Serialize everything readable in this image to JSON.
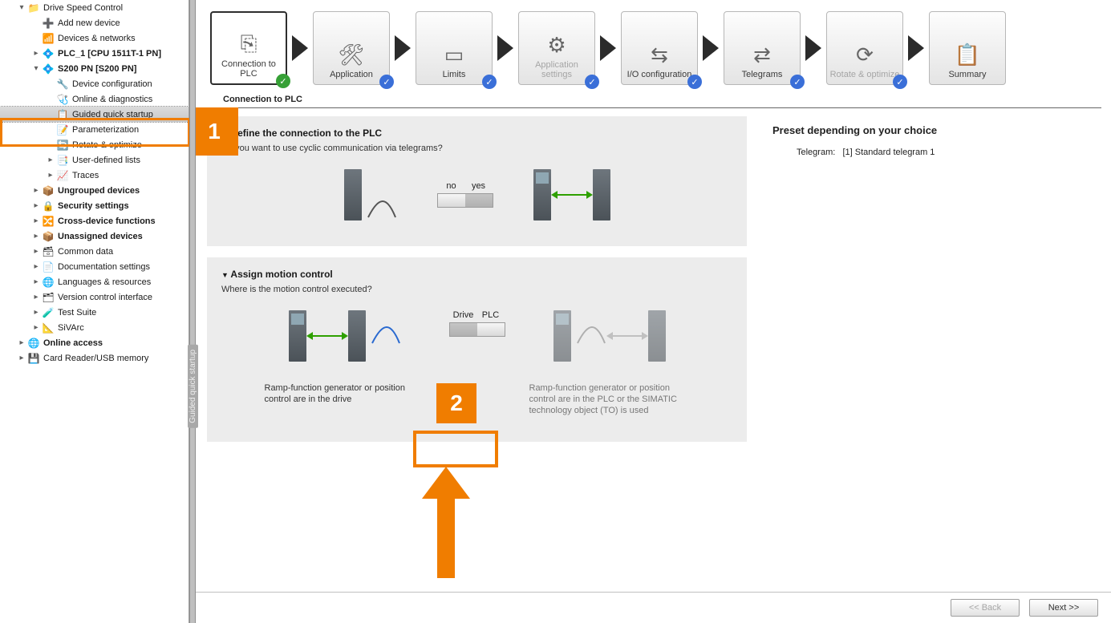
{
  "tree": [
    {
      "d": 1,
      "exp": "▾",
      "ic": "📁",
      "label": "Drive Speed Control",
      "bold": false
    },
    {
      "d": 2,
      "exp": "",
      "ic": "➕",
      "label": "Add new device"
    },
    {
      "d": 2,
      "exp": "",
      "ic": "📶",
      "label": "Devices & networks"
    },
    {
      "d": 2,
      "exp": "▸",
      "ic": "💠",
      "label": "PLC_1 [CPU 1511T-1 PN]",
      "bold": true
    },
    {
      "d": 2,
      "exp": "▾",
      "ic": "💠",
      "label": "S200 PN [S200 PN]",
      "bold": true
    },
    {
      "d": 3,
      "exp": "",
      "ic": "🔧",
      "label": "Device configuration"
    },
    {
      "d": 3,
      "exp": "",
      "ic": "🩺",
      "label": "Online & diagnostics"
    },
    {
      "d": 3,
      "exp": "",
      "ic": "📋",
      "label": "Guided quick startup",
      "selected": true
    },
    {
      "d": 3,
      "exp": "",
      "ic": "📝",
      "label": "Parameterization"
    },
    {
      "d": 3,
      "exp": "",
      "ic": "🔄",
      "label": "Rotate & optimize"
    },
    {
      "d": 3,
      "exp": "▸",
      "ic": "📑",
      "label": "User-defined lists"
    },
    {
      "d": 3,
      "exp": "▸",
      "ic": "📈",
      "label": "Traces"
    },
    {
      "d": 2,
      "exp": "▸",
      "ic": "📦",
      "label": "Ungrouped devices",
      "bold": true
    },
    {
      "d": 2,
      "exp": "▸",
      "ic": "🔒",
      "label": "Security settings",
      "bold": true
    },
    {
      "d": 2,
      "exp": "▸",
      "ic": "🔀",
      "label": "Cross-device functions",
      "bold": true
    },
    {
      "d": 2,
      "exp": "▸",
      "ic": "📦",
      "label": "Unassigned devices",
      "bold": true
    },
    {
      "d": 2,
      "exp": "▸",
      "ic": "🗃",
      "label": "Common data"
    },
    {
      "d": 2,
      "exp": "▸",
      "ic": "📄",
      "label": "Documentation settings"
    },
    {
      "d": 2,
      "exp": "▸",
      "ic": "🌐",
      "label": "Languages & resources"
    },
    {
      "d": 2,
      "exp": "▸",
      "ic": "🗂",
      "label": "Version control interface"
    },
    {
      "d": 2,
      "exp": "▸",
      "ic": "🧪",
      "label": "Test Suite"
    },
    {
      "d": 2,
      "exp": "▸",
      "ic": "📐",
      "label": "SiVArc"
    },
    {
      "d": 1,
      "exp": "▸",
      "ic": "🌐",
      "label": "Online access",
      "bold": true
    },
    {
      "d": 1,
      "exp": "▸",
      "ic": "💾",
      "label": "Card Reader/USB memory"
    }
  ],
  "side_tab": "Guided quick startup",
  "wizard": [
    {
      "label": "Connection to PLC",
      "state": "active",
      "badge": "✓"
    },
    {
      "label": "Application",
      "state": "done",
      "badge": "✓"
    },
    {
      "label": "Limits",
      "state": "done",
      "badge": "✓"
    },
    {
      "label": "Application settings",
      "state": "disabled",
      "badge": "✓"
    },
    {
      "label": "I/O configuration",
      "state": "done",
      "badge": "✓"
    },
    {
      "label": "Telegrams",
      "state": "done",
      "badge": "✓"
    },
    {
      "label": "Rotate & optimize",
      "state": "disabled",
      "badge": "✓"
    },
    {
      "label": "Summary",
      "state": "plain",
      "badge": ""
    }
  ],
  "section_title": "Connection to PLC",
  "card1": {
    "title": "Define the connection to the PLC",
    "q": "Do you want to use cyclic communication via telegrams?",
    "toggle_no": "no",
    "toggle_yes": "yes"
  },
  "card2": {
    "title": "Assign motion control",
    "q": "Where is the motion control executed?",
    "toggle_drive": "Drive",
    "toggle_plc": "PLC",
    "explain_left": "Ramp-function generator or position control are in the drive",
    "explain_right": "Ramp-function generator or position control are in the PLC or the SIMATIC technology object (TO) is used"
  },
  "right": {
    "title": "Preset depending on your choice",
    "row_label": "Telegram:",
    "row_value": "[1] Standard telegram 1"
  },
  "footer": {
    "back": "<< Back",
    "next": "Next >>"
  },
  "callouts": {
    "one": "1",
    "two": "2"
  }
}
